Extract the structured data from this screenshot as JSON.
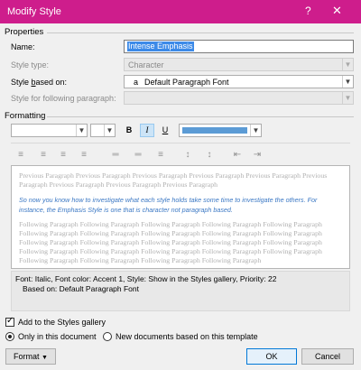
{
  "window": {
    "title": "Modify Style",
    "help_glyph": "?",
    "close_glyph": "✕"
  },
  "properties": {
    "section_label": "Properties",
    "name_label": "Name:",
    "name_value": "Intense Emphasis",
    "style_type_label": "Style type:",
    "style_type_value": "Character",
    "based_on_label": "Style based on:",
    "based_on_icon": "a",
    "based_on_value": "Default Paragraph Font",
    "following_label": "Style for following paragraph:",
    "following_value": ""
  },
  "formatting": {
    "section_label": "Formatting",
    "font_name": "",
    "font_size": "",
    "bold": "B",
    "italic": "I",
    "underline": "U",
    "font_color": "#5b9bd5"
  },
  "preview": {
    "previous_text": "Previous Paragraph Previous Paragraph Previous Paragraph Previous Paragraph Previous Paragraph Previous Paragraph Previous Paragraph Previous Paragraph Previous Paragraph",
    "sample_text": "So now you know how to investigate what each style holds take some time to investigate the others. For instance, the Emphasis Style is one that is character not paragraph based.",
    "following_text": "Following Paragraph Following Paragraph Following Paragraph Following Paragraph Following Paragraph Following Paragraph Following Paragraph Following Paragraph Following Paragraph Following Paragraph Following Paragraph Following Paragraph Following Paragraph Following Paragraph Following Paragraph Following Paragraph Following Paragraph Following Paragraph Following Paragraph Following Paragraph Following Paragraph Following Paragraph Following Paragraph Following Paragraph"
  },
  "description": {
    "line1": "Font: Italic, Font color: Accent 1, Style: Show in the Styles gallery, Priority: 22",
    "line2": "Based on: Default Paragraph Font"
  },
  "options": {
    "add_to_gallery": "Add to the Styles gallery",
    "only_in_document": "Only in this document",
    "new_documents": "New documents based on this template"
  },
  "buttons": {
    "format": "Format",
    "ok": "OK",
    "cancel": "Cancel"
  }
}
